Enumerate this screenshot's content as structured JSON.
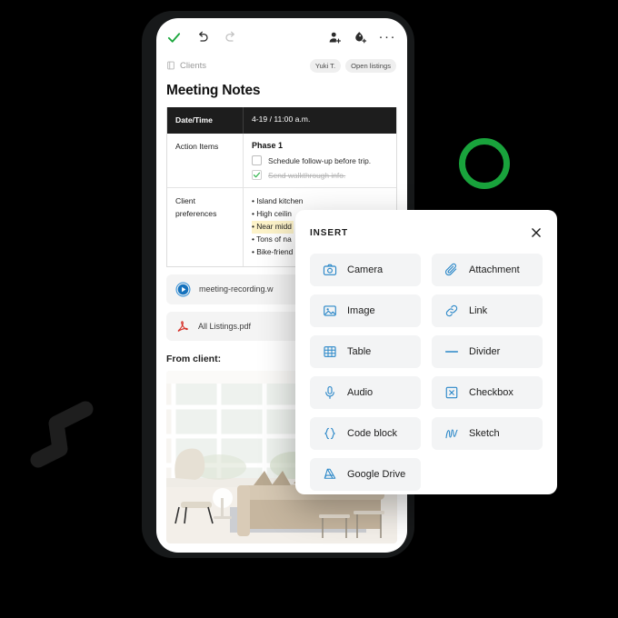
{
  "colors": {
    "background": "#000000",
    "accent_green": "#19a33c",
    "icon_blue": "#2a87c8",
    "pdf_red": "#d6322a",
    "highlight_yellow": "#fdf3c9",
    "panel_item_bg": "#f3f4f5",
    "table_header_bg": "#1d1d1d"
  },
  "toolbar": {
    "done_icon": "check-icon",
    "undo_icon": "undo-icon",
    "redo_icon": "redo-icon",
    "add_person_icon": "add-person-icon",
    "add_label_icon": "add-label-icon",
    "more_icon": "more-options-icon",
    "more_label": "···"
  },
  "breadcrumb": {
    "icon": "notebook-icon",
    "label": "Clients",
    "chips": [
      {
        "label": "Yuki T."
      },
      {
        "label": "Open listings"
      }
    ]
  },
  "note": {
    "title": "Meeting Notes",
    "table": {
      "header": {
        "label": "Date/Time",
        "value": "4-19 / 11:00 a.m."
      },
      "rows": [
        {
          "label": "Action Items",
          "phase": "Phase 1",
          "checklist": [
            {
              "text": "Schedule follow-up before trip.",
              "checked": false
            },
            {
              "text": "Send walkthrough info.",
              "checked": true
            }
          ]
        },
        {
          "label": "Client preferences",
          "bullets": [
            {
              "text": "• Island kitchen",
              "highlighted": false
            },
            {
              "text": "• High ceilin",
              "highlighted": false
            },
            {
              "text": "• Near midd",
              "highlighted": true
            },
            {
              "text": "• Tons of na",
              "highlighted": false
            },
            {
              "text": "• Bike-friend",
              "highlighted": false
            }
          ]
        }
      ]
    },
    "attachments": [
      {
        "name": "meeting-recording.w",
        "icon": "play-circle-icon"
      },
      {
        "name": "All Listings.pdf",
        "icon": "pdf-icon"
      }
    ],
    "from_client_label": "From client:",
    "photo_alt": "living-room-photo"
  },
  "insert_panel": {
    "title": "INSERT",
    "close_icon": "close-icon",
    "items": [
      {
        "label": "Camera",
        "icon": "camera-icon"
      },
      {
        "label": "Attachment",
        "icon": "attachment-icon"
      },
      {
        "label": "Image",
        "icon": "image-icon"
      },
      {
        "label": "Link",
        "icon": "link-icon"
      },
      {
        "label": "Table",
        "icon": "table-icon"
      },
      {
        "label": "Divider",
        "icon": "divider-icon"
      },
      {
        "label": "Audio",
        "icon": "microphone-icon"
      },
      {
        "label": "Checkbox",
        "icon": "checkbox-icon"
      },
      {
        "label": "Code block",
        "icon": "code-block-icon"
      },
      {
        "label": "Sketch",
        "icon": "sketch-icon"
      },
      {
        "label": "Google Drive",
        "icon": "google-drive-icon"
      }
    ]
  }
}
